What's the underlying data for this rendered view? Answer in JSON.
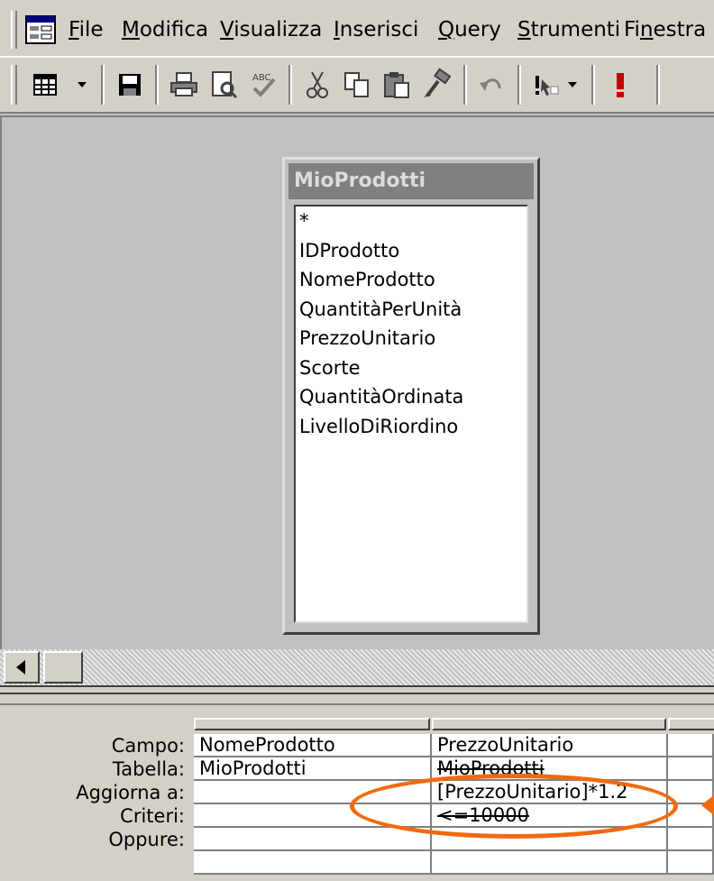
{
  "menu": {
    "items": [
      {
        "pre": "",
        "key": "F",
        "post": "ile"
      },
      {
        "pre": "",
        "key": "M",
        "post": "odifica"
      },
      {
        "pre": "",
        "key": "V",
        "post": "isualizza"
      },
      {
        "pre": "",
        "key": "I",
        "post": "nserisci"
      },
      {
        "pre": "",
        "key": "Q",
        "post": "uery"
      },
      {
        "pre": "",
        "key": "S",
        "post": "trumenti"
      },
      {
        "pre": "Fi",
        "key": "n",
        "post": "estra"
      }
    ]
  },
  "toolbar": {
    "icons": [
      "view-icon",
      "save-icon",
      "print-icon",
      "print-preview-icon",
      "spelling-icon",
      "cut-icon",
      "copy-icon",
      "paste-icon",
      "format-painter-icon",
      "undo-icon",
      "query-type-icon",
      "run-icon"
    ]
  },
  "field_list": {
    "title": "MioProdotti",
    "fields": [
      "*",
      "IDProdotto",
      "NomeProdotto",
      "QuantitàPerUnità",
      "PrezzoUnitario",
      "Scorte",
      "QuantitàOrdinata",
      "LivelloDiRiordino"
    ]
  },
  "grid": {
    "row_labels": {
      "campo": "Campo:",
      "tabella": "Tabella:",
      "aggiorna": "Aggiorna a:",
      "criteri": "Criteri:",
      "oppure": "Oppure:"
    },
    "col1": {
      "campo": "NomeProdotto",
      "tabella": "MioProdotti",
      "aggiorna": "",
      "criteri": "",
      "oppure": ""
    },
    "col2": {
      "campo": "PrezzoUnitario",
      "tabella": "MioProdotti",
      "aggiorna": "[PrezzoUnitario]*1.2",
      "criteri": "<=10000",
      "oppure": ""
    }
  },
  "colors": {
    "highlight": "#f06a0f",
    "title_bar": "#808080"
  }
}
